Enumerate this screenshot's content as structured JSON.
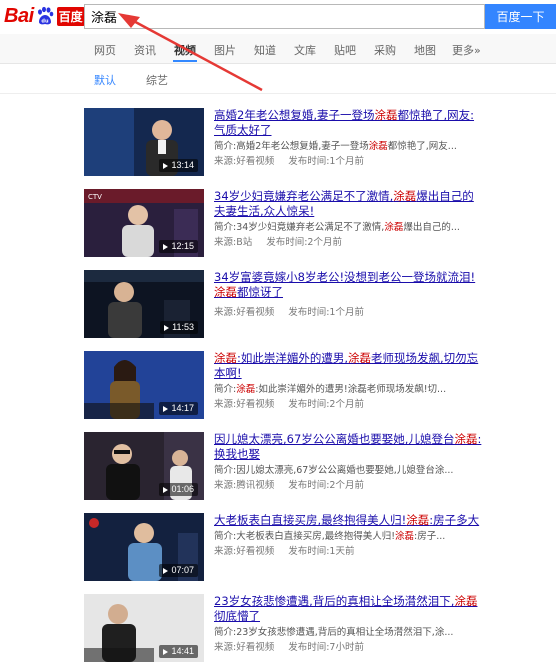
{
  "header": {
    "logo_text_1": "Bai",
    "logo_text_2": "du",
    "logo_text_3": "百度",
    "search_value": "涂磊",
    "search_button": "百度一下"
  },
  "nav": {
    "tabs": [
      {
        "label": "网页",
        "active": false
      },
      {
        "label": "资讯",
        "active": false
      },
      {
        "label": "视频",
        "active": true
      },
      {
        "label": "图片",
        "active": false
      },
      {
        "label": "知道",
        "active": false
      },
      {
        "label": "文库",
        "active": false
      },
      {
        "label": "贴吧",
        "active": false
      },
      {
        "label": "采购",
        "active": false
      },
      {
        "label": "地图",
        "active": false
      },
      {
        "label": "更多»",
        "active": false
      }
    ]
  },
  "filters": [
    {
      "label": "默认",
      "active": true
    },
    {
      "label": "综艺",
      "active": false
    }
  ],
  "results": [
    {
      "title_parts": [
        "高婚2年老公想复婚,妻子一登场",
        "涂磊",
        "都惊艳了,网友:气质太好了"
      ],
      "duration": "13:14",
      "desc_prefix": "简介:高婚2年老公想复婚,妻子一登场",
      "desc_hl": "涂磊",
      "desc_suffix": "都惊艳了,网友...",
      "source": "来源:好看视频",
      "published": "发布时间:1个月前"
    },
    {
      "title_parts": [
        "34岁少妇竟嫌弃老公满足不了激情,",
        "涂磊",
        "爆出自己的夫妻生活,众人惊呆!"
      ],
      "duration": "12:15",
      "desc_prefix": "简介:34岁少妇竟嫌弃老公满足不了激情,",
      "desc_hl": "涂磊",
      "desc_suffix": "爆出自己的...",
      "source": "来源:B站",
      "published": "发布时间:2个月前"
    },
    {
      "title_parts": [
        "34岁富婆竟嫁小8岁老公!没想到老公一登场就流泪!",
        "涂磊",
        "都惊讶了"
      ],
      "duration": "11:53",
      "desc_prefix": "",
      "desc_hl": "",
      "desc_suffix": "",
      "source": "来源:好看视频",
      "published": "发布时间:1个月前"
    },
    {
      "title_parts": [
        "",
        "涂磊",
        ":如此崇洋媚外的遭男,",
        "涂磊",
        "老师现场发飙,切勿忘本啊!"
      ],
      "duration": "14:17",
      "desc_prefix": "简介:",
      "desc_hl": "涂磊",
      "desc_suffix": ":如此崇洋媚外的遭男!涂磊老师现场发飙!切...",
      "source": "来源:好看视频",
      "published": "发布时间:2个月前"
    },
    {
      "title_parts": [
        "因儿媳太漂亮,67岁公公离婚也要娶她,儿媳登台",
        "涂磊",
        ":换我也娶"
      ],
      "duration": "01:06",
      "desc_prefix": "简介:因儿媳太漂亮,67岁公公离婚也要娶她,儿媳登台涂...",
      "desc_hl": "",
      "desc_suffix": "",
      "source": "来源:腾讯视频",
      "published": "发布时间:2个月前"
    },
    {
      "title_parts": [
        "大老板表白直接买房,最终抱得美人归!",
        "涂磊",
        ":房子多大"
      ],
      "duration": "07:07",
      "desc_prefix": "简介:大老板表白直接买房,最终抱得美人归!",
      "desc_hl": "涂磊",
      "desc_suffix": ":房子...",
      "source": "来源:好看视频",
      "published": "发布时间:1天前"
    },
    {
      "title_parts": [
        "23岁女孩悲惨遭遇,背后的真相让全场潸然泪下,",
        "涂磊",
        "彻底懵了"
      ],
      "duration": "14:41",
      "desc_prefix": "简介:23岁女孩悲惨遭遇,背后的真相让全场潸然泪下,涂...",
      "desc_hl": "",
      "desc_suffix": "",
      "source": "来源:好看视频",
      "published": "发布时间:7小时前"
    }
  ],
  "colors": {
    "accent": "#3385ff",
    "link": "#1a0dab",
    "highlight": "#cc0000",
    "brand_red": "#e10601",
    "arrow": "#e53935"
  }
}
